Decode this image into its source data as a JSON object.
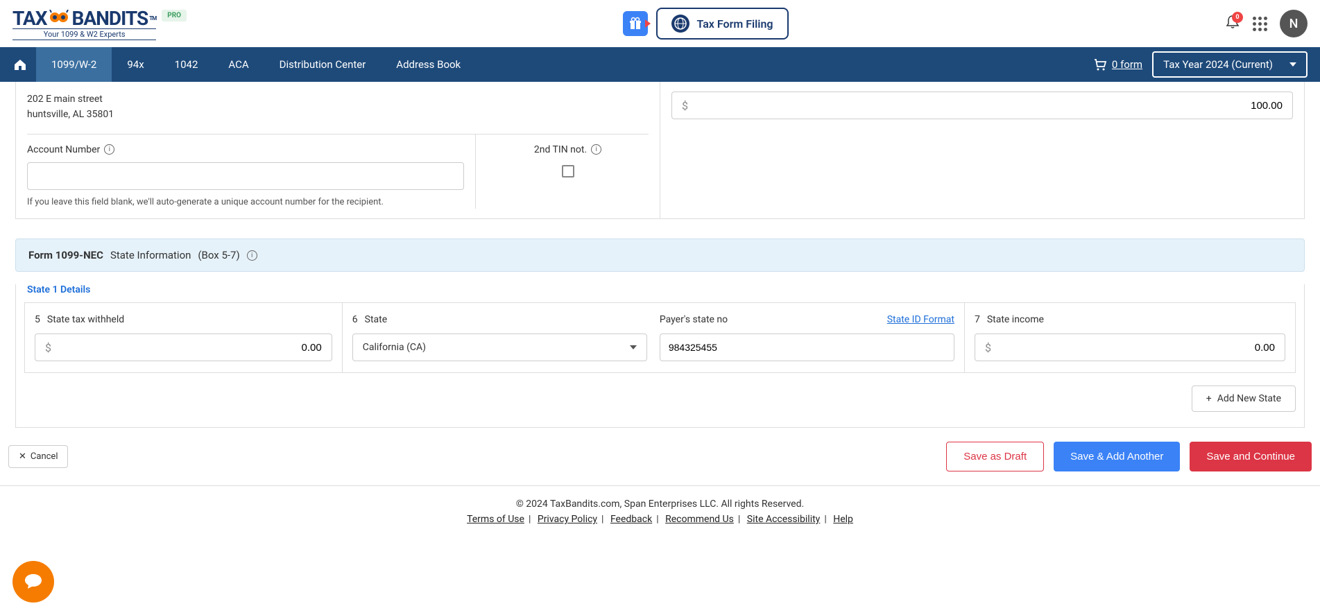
{
  "header": {
    "logo_text_pre": "TAX",
    "logo_text_post": "BANDITS",
    "logo_tm": "TM",
    "logo_tagline": "Your 1099 & W2 Experts",
    "pro_badge": "PRO",
    "tax_form_btn": "Tax Form Filing",
    "bell_count": "0",
    "avatar_initial": "N"
  },
  "nav": {
    "items": [
      "1099/W-2",
      "94x",
      "1042",
      "ACA",
      "Distribution Center",
      "Address Book"
    ],
    "cart_text": "0 form",
    "tax_year": "Tax Year 2024 (Current)"
  },
  "form": {
    "address_line1": "202 E main street",
    "address_line2": "huntsville, AL 35801",
    "account_number_label": "Account Number",
    "account_number_value": "",
    "account_help": "If you leave this field blank, we'll auto-generate a unique account number for the recipient.",
    "tin_label": "2nd TIN not.",
    "amount_value": "100.00"
  },
  "state_section": {
    "header_bold": "Form 1099-NEC",
    "header_mid": "State Information",
    "header_box": "(Box 5-7)",
    "details_label": "State 1 Details",
    "col5_num": "5",
    "col5_label": "State tax withheld",
    "col5_value": "0.00",
    "col6_num": "6",
    "col6_label": "State",
    "col6_value": "California (CA)",
    "payer_label": "Payer's state no",
    "state_id_link": "State ID Format",
    "payer_value": "984325455",
    "col7_num": "7",
    "col7_label": "State income",
    "col7_value": "0.00",
    "add_state": "Add New State"
  },
  "actions": {
    "cancel": "Cancel",
    "draft": "Save as Draft",
    "add_another": "Save & Add Another",
    "continue": "Save and Continue"
  },
  "footer": {
    "copyright": "© 2024 TaxBandits.com, Span Enterprises LLC. All rights Reserved.",
    "links": [
      "Terms of Use",
      "Privacy Policy",
      "Feedback",
      "Recommend Us",
      "Site Accessibility",
      "Help"
    ]
  }
}
